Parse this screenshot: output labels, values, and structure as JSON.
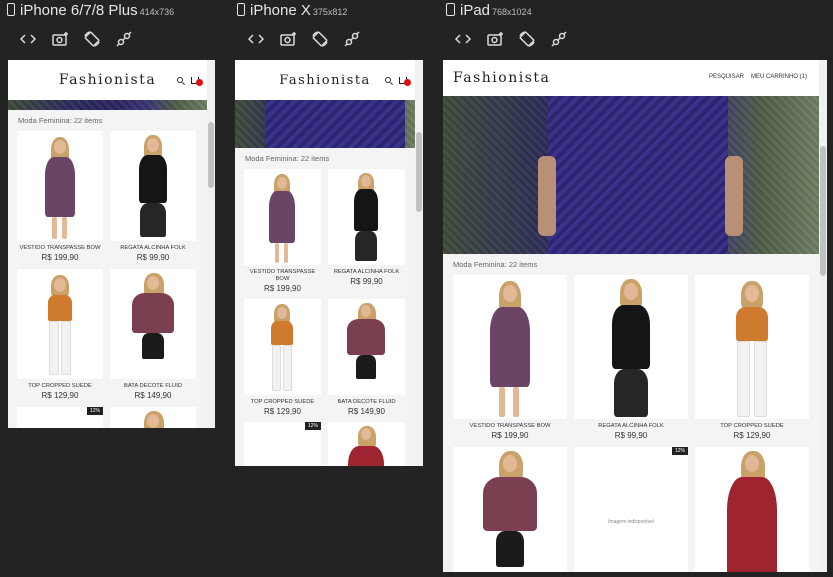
{
  "devices": [
    {
      "name": "iPhone 6/7/8 Plus",
      "size": "414x736"
    },
    {
      "name": "iPhone X",
      "size": "375x812"
    },
    {
      "name": "iPad",
      "size": "768x1024"
    }
  ],
  "toolbar": {
    "code": "code-icon",
    "screenshot": "camera-icon",
    "rotate": "rotate-icon",
    "network": "network-icon"
  },
  "site": {
    "logo": "Fashionista",
    "section_title": "Moda Feminina: 22 items",
    "nav_search": "PESQUISAR",
    "nav_cart": "MEU CARRINHO (1)",
    "no_image": "Imagem indisponível"
  },
  "products": [
    {
      "name": "VESTIDO TRANSPASSE BOW",
      "price": "R$ 199,90"
    },
    {
      "name": "REGATA ALCINHA FOLK",
      "price": "R$ 99,90"
    },
    {
      "name": "TOP CROPPED SUEDE",
      "price": "R$ 129,90"
    },
    {
      "name": "BATA DECOTE FLUID",
      "price": "R$ 149,90"
    }
  ],
  "discount": "12%",
  "colors": {
    "background": "#232323",
    "cart_badge": "#e01010",
    "accent_dress": "#2a2460"
  }
}
